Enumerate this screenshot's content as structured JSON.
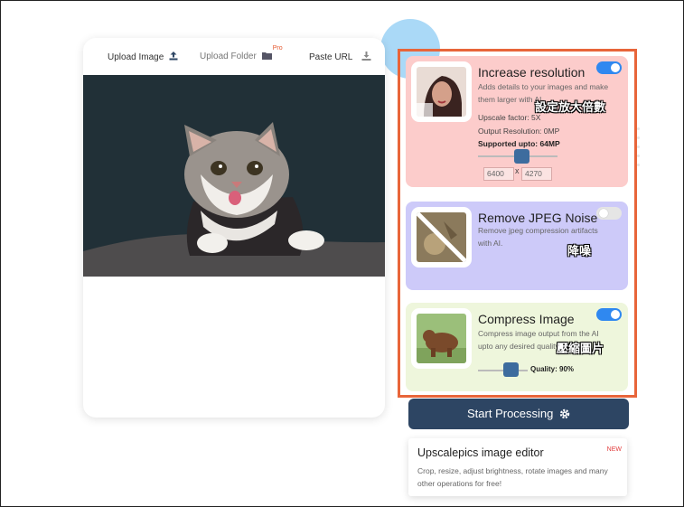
{
  "tabs": {
    "upload_image": "Upload Image",
    "upload_folder": "Upload Folder",
    "pro_badge": "Pro",
    "paste_url": "Paste URL"
  },
  "features": {
    "increase_resolution": {
      "title": "Increase resolution",
      "description": "Adds details to your images and make them larger with AI",
      "upscale_factor": "Upscale factor: 5X",
      "output_resolution": "Output Resolution: 0MP",
      "supported": "Supported upto: 64MP",
      "width_value": "6400",
      "height_value": "4270",
      "separator": "x",
      "enabled": true,
      "annotation": "設定放大倍數"
    },
    "remove_jpeg_noise": {
      "title": "Remove JPEG Noise",
      "description": "Remove jpeg compression artifacts with AI.",
      "enabled": false,
      "annotation": "降噪"
    },
    "compress_image": {
      "title": "Compress Image",
      "description": "Compress image output from the AI upto any desired quality.",
      "quality_label": "Quality: 90%",
      "quality": 0.9,
      "enabled": true,
      "annotation": "壓縮圖片"
    }
  },
  "start_button": {
    "label": "Start Processing"
  },
  "editor_card": {
    "title": "Upscalepics image editor",
    "badge": "NEW",
    "description": "Crop, resize, adjust brightness, rotate images and many other operations for free!"
  },
  "colors": {
    "accent_orange": "#e8653a",
    "toggle_on": "#2f88f0",
    "button_dark": "#2d4563",
    "card_pink": "#fccccb",
    "card_lavender": "#cdcaf9",
    "card_green": "#eef6dc"
  },
  "icons": [
    "upload-icon",
    "folder-icon",
    "download-icon",
    "gear-icon"
  ]
}
